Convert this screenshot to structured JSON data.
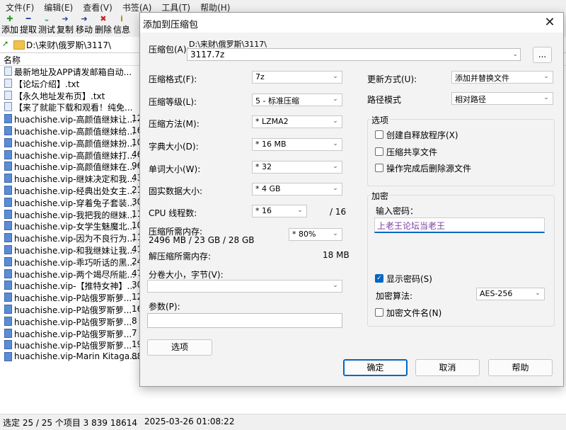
{
  "menu": [
    "文件(F)",
    "编辑(E)",
    "查看(V)",
    "书签(A)",
    "工具(T)",
    "帮助(H)"
  ],
  "toolbar": {
    "add": "添加",
    "extract": "提取",
    "test": "测试",
    "copy": "复制",
    "move": "移动",
    "delete": "删除",
    "info": "信息",
    "add_glyph": "✚",
    "extract_glyph": "━",
    "test_glyph": "⌄",
    "copy_glyph": "➔",
    "move_glyph": "➔",
    "delete_glyph": "✖",
    "info_glyph": "i"
  },
  "address": {
    "path": "D:\\来财\\俄罗斯\\3117\\"
  },
  "list": {
    "header": "名称",
    "files": [
      {
        "name": "最新地址及APP请发邮箱自动...",
        "size": ""
      },
      {
        "name": "【论坛介绍】.txt",
        "size": ""
      },
      {
        "name": "【永久地址发布页】.txt",
        "size": ""
      },
      {
        "name": "【来了就能下载和观看！纯免...",
        "size": ""
      },
      {
        "name": "huachishe.vip-高颜值继妹让...",
        "size": "12"
      },
      {
        "name": "huachishe.vip-高颜值继妹给...",
        "size": "16"
      },
      {
        "name": "huachishe.vip-高颜值继妹扮...",
        "size": "10"
      },
      {
        "name": "huachishe.vip-高颜值继妹打...",
        "size": "46"
      },
      {
        "name": "huachishe.vip-高颜值继妹在...",
        "size": "96"
      },
      {
        "name": "huachishe.vip-继妹决定和我...",
        "size": "43"
      },
      {
        "name": "huachishe.vip-经典出处女主...",
        "size": "21"
      },
      {
        "name": "huachishe.vip-穿着兔子套装...",
        "size": "30"
      },
      {
        "name": "huachishe.vip-我把我的继妹...",
        "size": "11"
      },
      {
        "name": "huachishe.vip-女学生魅魔北...",
        "size": "10"
      },
      {
        "name": "huachishe.vip-因为不良行为...",
        "size": "11"
      },
      {
        "name": "huachishe.vip-和我继妹让我...",
        "size": "41"
      },
      {
        "name": "huachishe.vip-乖巧听话的黑...",
        "size": "24"
      },
      {
        "name": "huachishe.vip-两个竭尽所能...",
        "size": "47"
      },
      {
        "name": "huachishe.vip-【推特女神】...",
        "size": "30"
      },
      {
        "name": "huachishe.vip-P站俄罗斯萝...",
        "size": "12"
      },
      {
        "name": "huachishe.vip-P站俄罗斯萝...",
        "size": "16"
      },
      {
        "name": "huachishe.vip-P站俄罗斯萝...",
        "size": "8"
      },
      {
        "name": "huachishe.vip-P站俄罗斯萝...",
        "size": "7"
      },
      {
        "name": "huachishe.vip-P站俄罗斯萝...",
        "size": "19"
      },
      {
        "name": "huachishe.vip-Marin Kitaga...",
        "size": "88"
      }
    ]
  },
  "status": {
    "selection": "选定 25 / 25 个项目 3 839 18614",
    "date": "2025-03-26 01:08:22"
  },
  "dialog": {
    "title": "添加到压缩包",
    "close_glyph": "✕",
    "archive_label": "压缩包(A):",
    "archive_dir": "D:\\来财\\俄罗斯\\3117\\",
    "archive_name": "3117.7z",
    "browse": "...",
    "format_label": "压缩格式(F):",
    "format_value": "7z",
    "level_label": "压缩等级(L):",
    "level_value": "5 - 标准压缩",
    "method_label": "压缩方法(M):",
    "method_value": "*  LZMA2",
    "dict_label": "字典大小(D):",
    "dict_value": "*  16 MB",
    "word_label": "单词大小(W):",
    "word_value": "*  32",
    "solid_label": "固实数据大小:",
    "solid_value": "*  4 GB",
    "cpu_label": "CPU 线程数:",
    "cpu_value": "*  16",
    "cpu_total": "/ 16",
    "mem_comp_label": "压缩所需内存:",
    "mem_comp_value": "2496 MB / 23 GB / 28 GB",
    "mem_pct": "* 80%",
    "mem_decomp_label": "解压缩所需内存:",
    "mem_decomp_value": "18 MB",
    "volume_label": "分卷大小，字节(V):",
    "volume_value": "",
    "params_label": "参数(P):",
    "params_value": "",
    "options_button": "选项",
    "update_label": "更新方式(U):",
    "update_value": "添加并替换文件",
    "path_label": "路径模式",
    "path_value": "相对路径",
    "options_group": "选项",
    "opt_sfx": "创建自释放程序(X)",
    "opt_shared": "压缩共享文件",
    "opt_delete": "操作完成后删除源文件",
    "enc_group": "加密",
    "pwd_label": "输入密码：",
    "pwd_value": "上老王论坛当老王",
    "show_pwd": "显示密码(S)",
    "enc_method_label": "加密算法:",
    "enc_method_value": "AES-256",
    "enc_names": "加密文件名(N)",
    "ok": "确定",
    "cancel": "取消",
    "help": "帮助",
    "check_glyph": "✓",
    "arrow_glyph": "⌄"
  }
}
